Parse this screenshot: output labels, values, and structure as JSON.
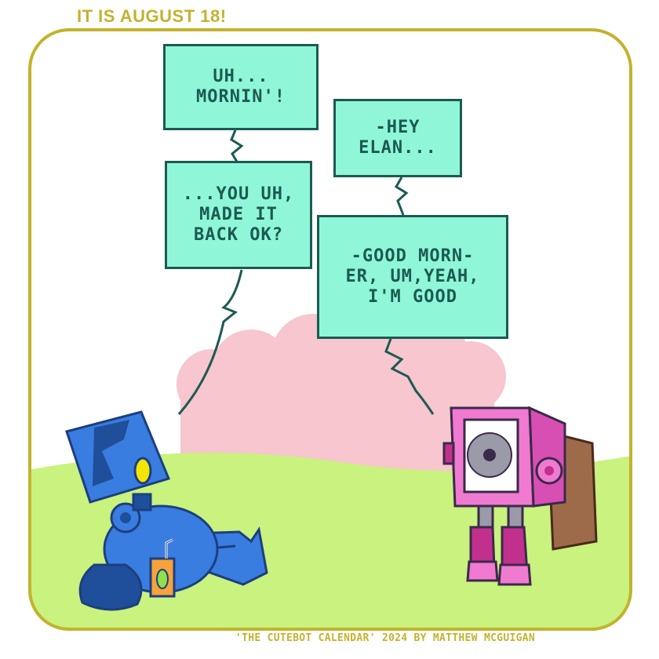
{
  "header": {
    "date_text": "IT IS AUGUST 18!"
  },
  "footer": {
    "credit_text": "'THE CUTEBOT CALENDAR' 2024 BY MATTHEW MCGUIGAN"
  },
  "dialogue": {
    "blue_bot": [
      {
        "text": "UH...\nMORNIN'!"
      },
      {
        "text": "...YOU UH,\nMADE IT\nBACK OK?"
      }
    ],
    "pink_bot": [
      {
        "text": "-HEY\nELAN..."
      },
      {
        "text": "-GOOD MORN-\nER, UM,YEAH,\nI'M GOOD"
      }
    ]
  },
  "colors": {
    "frame": "#c2b32e",
    "grass": "#c9f27e",
    "bush": "#f7c6cf",
    "bubble_fill": "#8ff7d8",
    "bubble_outline": "#1c5a52",
    "blue_bot": "#3a7de0",
    "pink_bot": "#f07ad0"
  }
}
